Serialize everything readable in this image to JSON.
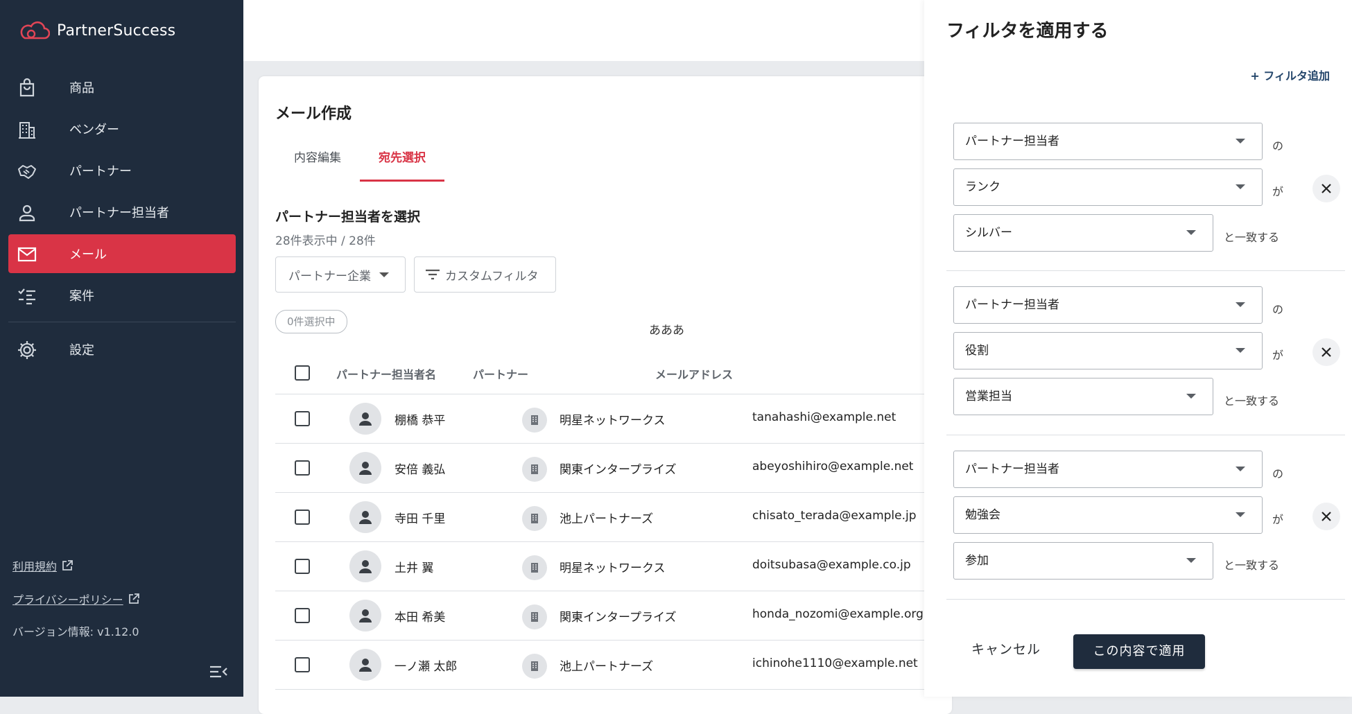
{
  "app": {
    "name": "PartnerSuccess",
    "accent_color": "#d93446",
    "sidebar_color": "#1f2c3d"
  },
  "sidebar": {
    "items": [
      {
        "label": "商品",
        "icon": "bag-icon"
      },
      {
        "label": "ベンダー",
        "icon": "building-icon"
      },
      {
        "label": "パートナー",
        "icon": "handshake-icon"
      },
      {
        "label": "パートナー担当者",
        "icon": "person-icon"
      },
      {
        "label": "メール",
        "icon": "mail-icon",
        "active": true
      },
      {
        "label": "案件",
        "icon": "checklist-icon"
      }
    ],
    "settings": {
      "label": "設定",
      "icon": "gear-icon"
    },
    "terms": "利用規約",
    "privacy": "プライバシーポリシー",
    "version": "バージョン情報: v1.12.0"
  },
  "main": {
    "title": "メール作成",
    "tabs": [
      "内容編集",
      "宛先選択"
    ],
    "active_tab": 1,
    "section_title": "パートナー担当者を選択",
    "count": "28件表示中 / 28件",
    "filter_company": "パートナー企業",
    "filter_custom": "カスタムフィルタ",
    "selected": "0件選択中",
    "note": "あああ",
    "columns": [
      "パートナー担当者名",
      "パートナー",
      "メールアドレス"
    ],
    "rows": [
      {
        "name": "棚橋 恭平",
        "partner": "明星ネットワークス",
        "email": "tanahashi@example.net"
      },
      {
        "name": "安倍 義弘",
        "partner": "関東インタープライズ",
        "email": "abeyoshihiro@example.net"
      },
      {
        "name": "寺田 千里",
        "partner": "池上パートナーズ",
        "email": "chisato_terada@example.jp"
      },
      {
        "name": "土井 翼",
        "partner": "明星ネットワークス",
        "email": "doitsubasa@example.co.jp"
      },
      {
        "name": "本田 希美",
        "partner": "関東インタープライズ",
        "email": "honda_nozomi@example.org"
      },
      {
        "name": "一ノ瀬 太郎",
        "partner": "池上パートナーズ",
        "email": "ichinohe1110@example.net"
      }
    ]
  },
  "panel": {
    "title": "フィルタを適用する",
    "add_filter": "+ フィルタ追加",
    "connectors": {
      "of": "の",
      "ga": "が",
      "match": "と一致する"
    },
    "groups": [
      {
        "entity": "パートナー担当者",
        "field": "ランク",
        "value": "シルバー"
      },
      {
        "entity": "パートナー担当者",
        "field": "役割",
        "value": "営業担当"
      },
      {
        "entity": "パートナー担当者",
        "field": "勉強会",
        "value": "参加"
      }
    ],
    "cancel": "キャンセル",
    "apply": "この内容で適用"
  }
}
